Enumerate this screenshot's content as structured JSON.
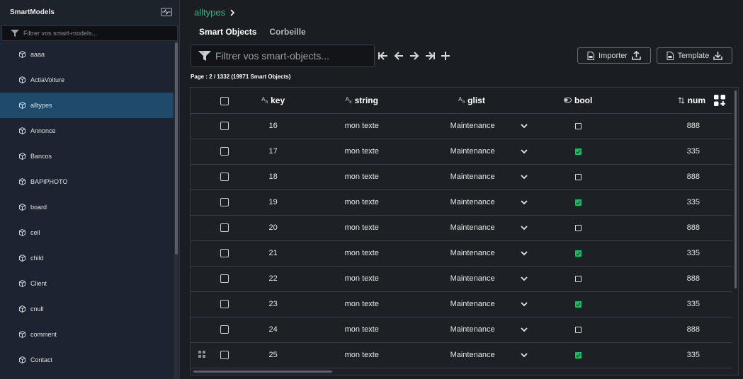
{
  "sidebar": {
    "title": "SmartModels",
    "filter_placeholder": "Filtrer vos smart-models...",
    "items": [
      {
        "label": "aaaa",
        "active": false
      },
      {
        "label": "ActiaVoiture",
        "active": false
      },
      {
        "label": "alltypes",
        "active": true
      },
      {
        "label": "Annonce",
        "active": false
      },
      {
        "label": "Bancos",
        "active": false
      },
      {
        "label": "BAPIPHOTO",
        "active": false
      },
      {
        "label": "board",
        "active": false
      },
      {
        "label": "cell",
        "active": false
      },
      {
        "label": "child",
        "active": false
      },
      {
        "label": "Client",
        "active": false
      },
      {
        "label": "cnull",
        "active": false
      },
      {
        "label": "comment",
        "active": false
      },
      {
        "label": "Contact",
        "active": false
      }
    ]
  },
  "breadcrumb": {
    "current": "alltypes",
    "separator": "›"
  },
  "tabs": {
    "smart_objects": "Smart Objects",
    "trash": "Corbeille"
  },
  "search": {
    "placeholder": "Filtrer vos smart-objects..."
  },
  "toolbar": {
    "import_label": "Importer",
    "template_label": "Template"
  },
  "page_info": "Page : 2 / 1332 (19971 Smart Objects)",
  "table": {
    "columns": {
      "key": "key",
      "string": "string",
      "glist": "glist",
      "bool": "bool",
      "num": "num"
    },
    "type_icon_text": "A",
    "rows": [
      {
        "key": "16",
        "string": "mon texte",
        "glist": "Maintenance",
        "bool": false,
        "num": "888"
      },
      {
        "key": "17",
        "string": "mon texte",
        "glist": "Maintenance",
        "bool": true,
        "num": "335"
      },
      {
        "key": "18",
        "string": "mon texte",
        "glist": "Maintenance",
        "bool": false,
        "num": "888"
      },
      {
        "key": "19",
        "string": "mon texte",
        "glist": "Maintenance",
        "bool": true,
        "num": "335"
      },
      {
        "key": "20",
        "string": "mon texte",
        "glist": "Maintenance",
        "bool": false,
        "num": "888"
      },
      {
        "key": "21",
        "string": "mon texte",
        "glist": "Maintenance",
        "bool": true,
        "num": "335"
      },
      {
        "key": "22",
        "string": "mon texte",
        "glist": "Maintenance",
        "bool": false,
        "num": "888"
      },
      {
        "key": "23",
        "string": "mon texte",
        "glist": "Maintenance",
        "bool": true,
        "num": "335"
      },
      {
        "key": "24",
        "string": "mon texte",
        "glist": "Maintenance",
        "bool": false,
        "num": "888"
      },
      {
        "key": "25",
        "string": "mon texte",
        "glist": "Maintenance",
        "bool": true,
        "num": "335"
      }
    ]
  },
  "colors": {
    "accent_green": "#3fb27f",
    "active_item": "#1f4a6a",
    "bool_on": "#28b463"
  }
}
